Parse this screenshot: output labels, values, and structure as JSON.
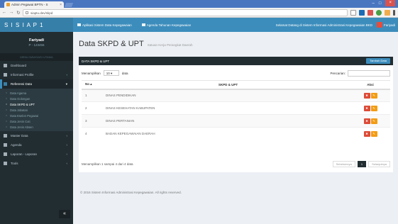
{
  "browser": {
    "tab_title": "Admin Pegawai BPTN - S",
    "url": "siaptu.dev/skpd",
    "window_min": "–",
    "window_max": "□",
    "window_close": "×"
  },
  "sidebar": {
    "brand": "S I S I A P 1",
    "user_name": "Fariyadi",
    "user_id": "P - 123456",
    "menu_header": "MENU NAVIGASI UTAMA",
    "items": [
      {
        "label": "Dashboard",
        "has_caret": false
      },
      {
        "label": "Informasi Profile",
        "has_caret": true
      },
      {
        "label": "Referensi Data",
        "has_caret": true,
        "active": true
      },
      {
        "label": "Master Data",
        "has_caret": true
      },
      {
        "label": "Agenda",
        "has_caret": true
      },
      {
        "label": "Laporan - Laporan",
        "has_caret": true
      },
      {
        "label": "Tools",
        "has_caret": true
      }
    ],
    "submenu": [
      {
        "label": "Data Agama"
      },
      {
        "label": "Data Golongan"
      },
      {
        "label": "Data SKPD & UPT",
        "active": true
      },
      {
        "label": "Data Jabatan"
      },
      {
        "label": "Data Eselon Pegawai"
      },
      {
        "label": "Data Jenis Cuti"
      },
      {
        "label": "Data Jenis Absen"
      }
    ],
    "collapse_glyph": "«"
  },
  "topnav": {
    "link1": "Aplikasi Sistem Data Kepegawaian",
    "link2": "Agenda Tahunan Kepegawaian",
    "right_text": "Selamat Datang di Sistem Informasi Administrasi Kepegawaian BKD",
    "user_label": "Fariyadi"
  },
  "page": {
    "title": "Data SKPD & UPT",
    "subtitle": "Satuan Kerja Perangkat Daerah",
    "box_title": "DATA SKPD & UPT",
    "add_button": "Tambah Data",
    "show_label": "Menampilkan",
    "show_value": "10",
    "show_suffix": "data",
    "search_label": "Pencarian:",
    "search_value": "",
    "columns": {
      "no": "No",
      "name": "SKPD & UPT",
      "action": "Aksi"
    },
    "rows": [
      {
        "no": "1",
        "name": "DINAS PENDIDIKAN"
      },
      {
        "no": "2",
        "name": "DINAS KESEHATAN KABUPATEN"
      },
      {
        "no": "3",
        "name": "DINAS PERTANIAN"
      },
      {
        "no": "4",
        "name": "BADAN KEPEGAWAIAN DAERAH"
      }
    ],
    "delete_glyph": "✖",
    "edit_glyph": "✎",
    "info_text": "Menampilkan 1 sampai 4 dari 4 data",
    "prev_label": "Sebelumnya",
    "current_page": "1",
    "next_label": "Selanjutnya",
    "copyright": "© 2016 Sistem Informasi Administrasi Kepegawaian. All rights reserved."
  },
  "colors": {
    "sidebar_bg": "#222d32",
    "brand_bg": "#367fa9",
    "topnav_bg": "#3c8dbc",
    "content_bg": "#ecf0f5",
    "delete_btn": "#dd4b39",
    "edit_btn": "#f39c12"
  }
}
